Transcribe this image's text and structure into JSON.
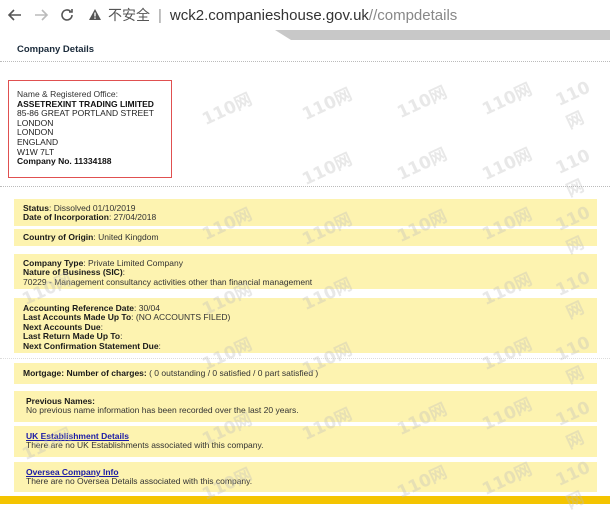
{
  "browser": {
    "insecure_label": "不安全",
    "url_host": "wck2.companieshouse.gov.uk",
    "url_path": "//compdetails"
  },
  "page": {
    "title": "Company Details"
  },
  "office": {
    "label": "Name & Registered Office:",
    "name": "ASSETREXINT TRADING LIMITED",
    "lines": [
      "85-86 GREAT PORTLAND STREET",
      "LONDON",
      "LONDON",
      "ENGLAND",
      "W1W 7LT"
    ],
    "company_no_label": "Company No.",
    "company_no": "11334188"
  },
  "status": {
    "status_label": "Status",
    "status_value": ": Dissolved 01/10/2019",
    "inc_label": "Date of Incorporation",
    "inc_value": ": 27/04/2018"
  },
  "origin": {
    "label": "Country of Origin",
    "value": ": United Kingdom"
  },
  "type": {
    "type_label": "Company Type",
    "type_value": ": Private Limited Company",
    "nature_label": "Nature of Business (SIC)",
    "nature_colon": ":",
    "nature_value": "70229 - Management consultancy activities other than financial management"
  },
  "accounts": {
    "ref_label": "Accounting Reference Date",
    "ref_value": ": 30/04",
    "last_label": "Last Accounts Made Up To",
    "last_value": ":  (NO ACCOUNTS FILED)",
    "next_label": "Next Accounts Due",
    "next_value": ":",
    "return_label": "Last Return Made Up To",
    "return_value": ":",
    "confirm_label": "Next Confirmation Statement Due",
    "confirm_value": ":"
  },
  "mortgage": {
    "label": "Mortgage: Number of charges:",
    "value": " ( 0 outstanding / 0 satisfied / 0 part satisfied )"
  },
  "previous": {
    "label": "Previous Names:",
    "value": "No previous name information has been recorded over the last 20 years."
  },
  "uk_est": {
    "link": "UK Establishment Details",
    "value": "There are no UK Establishments associated with this company."
  },
  "oversea": {
    "link": "Oversea Company Info",
    "value": "There are no Oversea Details associated with this company."
  },
  "watermark": "110网"
}
